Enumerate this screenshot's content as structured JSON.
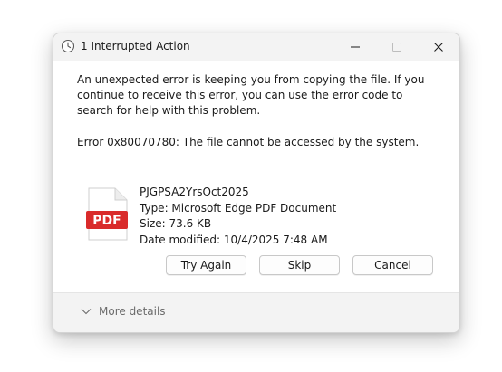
{
  "window": {
    "title": "1 Interrupted Action",
    "icon": "clock-icon"
  },
  "message": {
    "text": "An unexpected error is keeping you from copying the file. If you continue to receive this error, you can use the error code to search for help with this problem.",
    "error": "Error 0x80070780: The file cannot be accessed by the system."
  },
  "file": {
    "icon": "pdf-file-icon",
    "icon_label": "PDF",
    "name": "PJGPSA2YrsOct2025",
    "type": "Type: Microsoft Edge PDF Document",
    "size": "Size: 73.6 KB",
    "modified": "Date modified: 10/4/2025 7:48 AM"
  },
  "buttons": {
    "try_again": "Try Again",
    "skip": "Skip",
    "cancel": "Cancel"
  },
  "footer": {
    "more_details": "More details"
  },
  "colors": {
    "pdf_red": "#d92b2b",
    "dialog_bg": "#f3f3f3",
    "muted_text": "#6b6b6b"
  }
}
